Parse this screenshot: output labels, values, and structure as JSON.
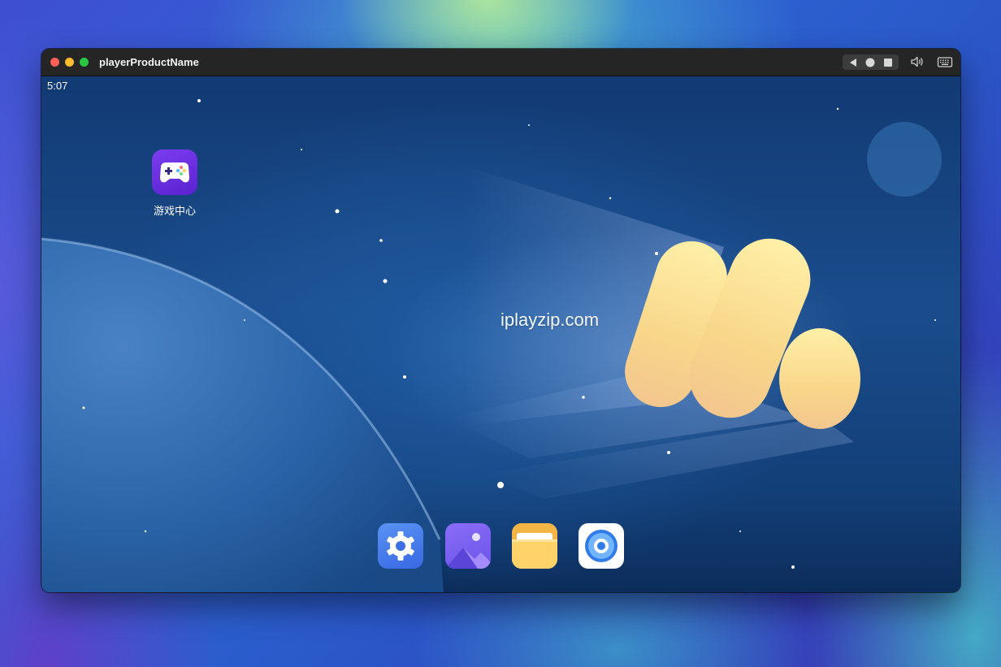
{
  "window": {
    "title": "playerProductName"
  },
  "toolbar": {
    "icons": [
      "back-triangle-icon",
      "home-circle-icon",
      "recent-square-icon",
      "speaker-icon",
      "keyboard-icon"
    ]
  },
  "android": {
    "status_time": "5:07",
    "apps": [
      {
        "label": "游戏中心",
        "icon": "gamepad-icon"
      }
    ],
    "watermark": "iplayzip.com",
    "page_indicator": {
      "pages": 1,
      "current": 1
    },
    "dock": [
      {
        "icon": "settings-gear-icon"
      },
      {
        "icon": "gallery-icon"
      },
      {
        "icon": "folder-icon"
      },
      {
        "icon": "browser-icon"
      }
    ]
  },
  "colors": {
    "titlebar": "#252525",
    "traffic_red": "#fe5f57",
    "traffic_yellow": "#febc2e",
    "traffic_green": "#28c840",
    "screen_blue": "#1a4c8c",
    "app_purple": "#6a2ee0"
  }
}
